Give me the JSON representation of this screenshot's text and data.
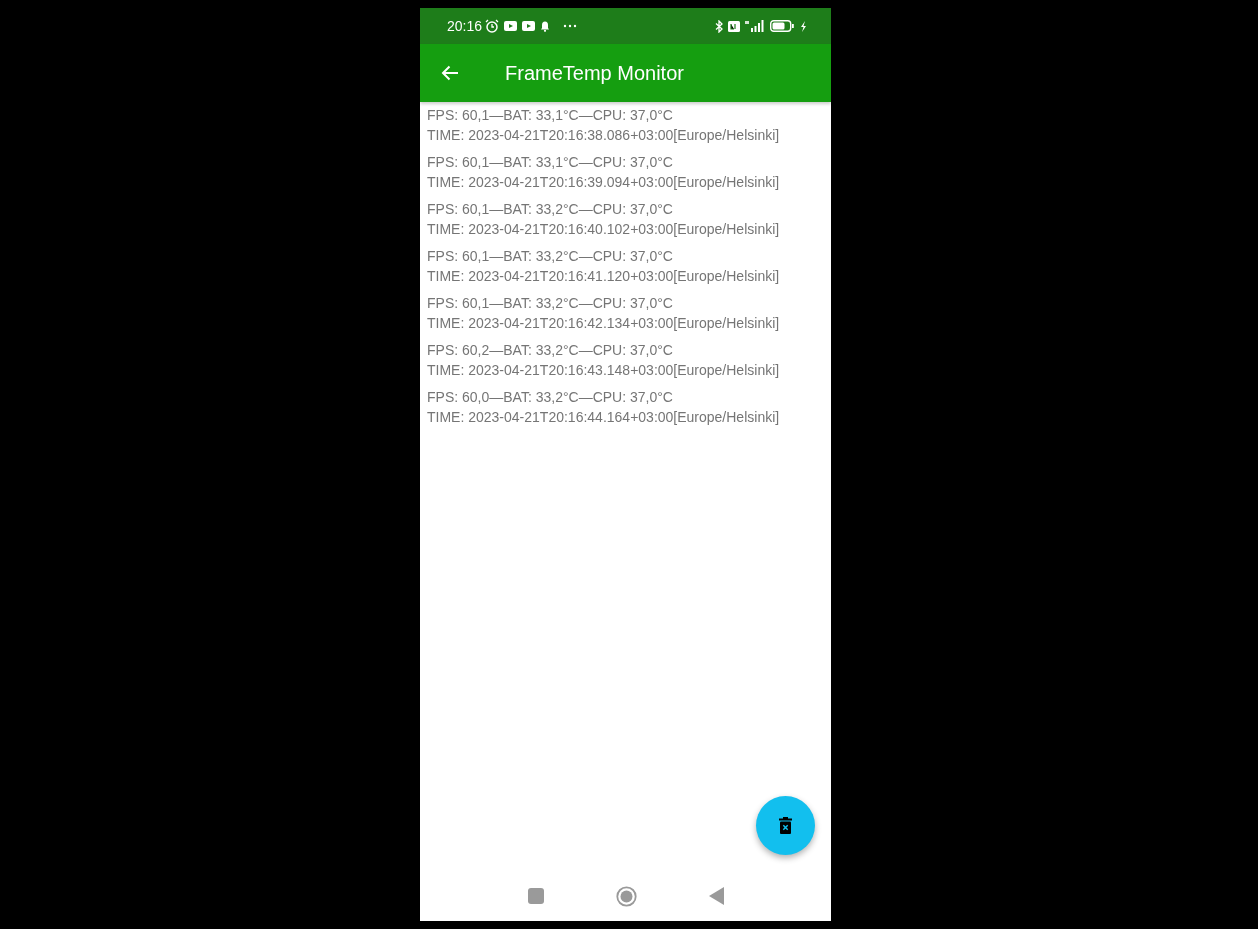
{
  "status_bar": {
    "time": "20:16"
  },
  "app_bar": {
    "title": "FrameTemp Monitor"
  },
  "readings": [
    {
      "values": "FPS: 60,1—BAT: 33,1°C—CPU: 37,0°C",
      "time": "TIME: 2023-04-21T20:16:38.086+03:00[Europe/Helsinki]"
    },
    {
      "values": "FPS: 60,1—BAT: 33,1°C—CPU: 37,0°C",
      "time": "TIME: 2023-04-21T20:16:39.094+03:00[Europe/Helsinki]"
    },
    {
      "values": "FPS: 60,1—BAT: 33,2°C—CPU: 37,0°C",
      "time": "TIME: 2023-04-21T20:16:40.102+03:00[Europe/Helsinki]"
    },
    {
      "values": "FPS: 60,1—BAT: 33,2°C—CPU: 37,0°C",
      "time": "TIME: 2023-04-21T20:16:41.120+03:00[Europe/Helsinki]"
    },
    {
      "values": "FPS: 60,1—BAT: 33,2°C—CPU: 37,0°C",
      "time": "TIME: 2023-04-21T20:16:42.134+03:00[Europe/Helsinki]"
    },
    {
      "values": "FPS: 60,2—BAT: 33,2°C—CPU: 37,0°C",
      "time": "TIME: 2023-04-21T20:16:43.148+03:00[Europe/Helsinki]"
    },
    {
      "values": "FPS: 60,0—BAT: 33,2°C—CPU: 37,0°C",
      "time": "TIME: 2023-04-21T20:16:44.164+03:00[Europe/Helsinki]"
    }
  ]
}
